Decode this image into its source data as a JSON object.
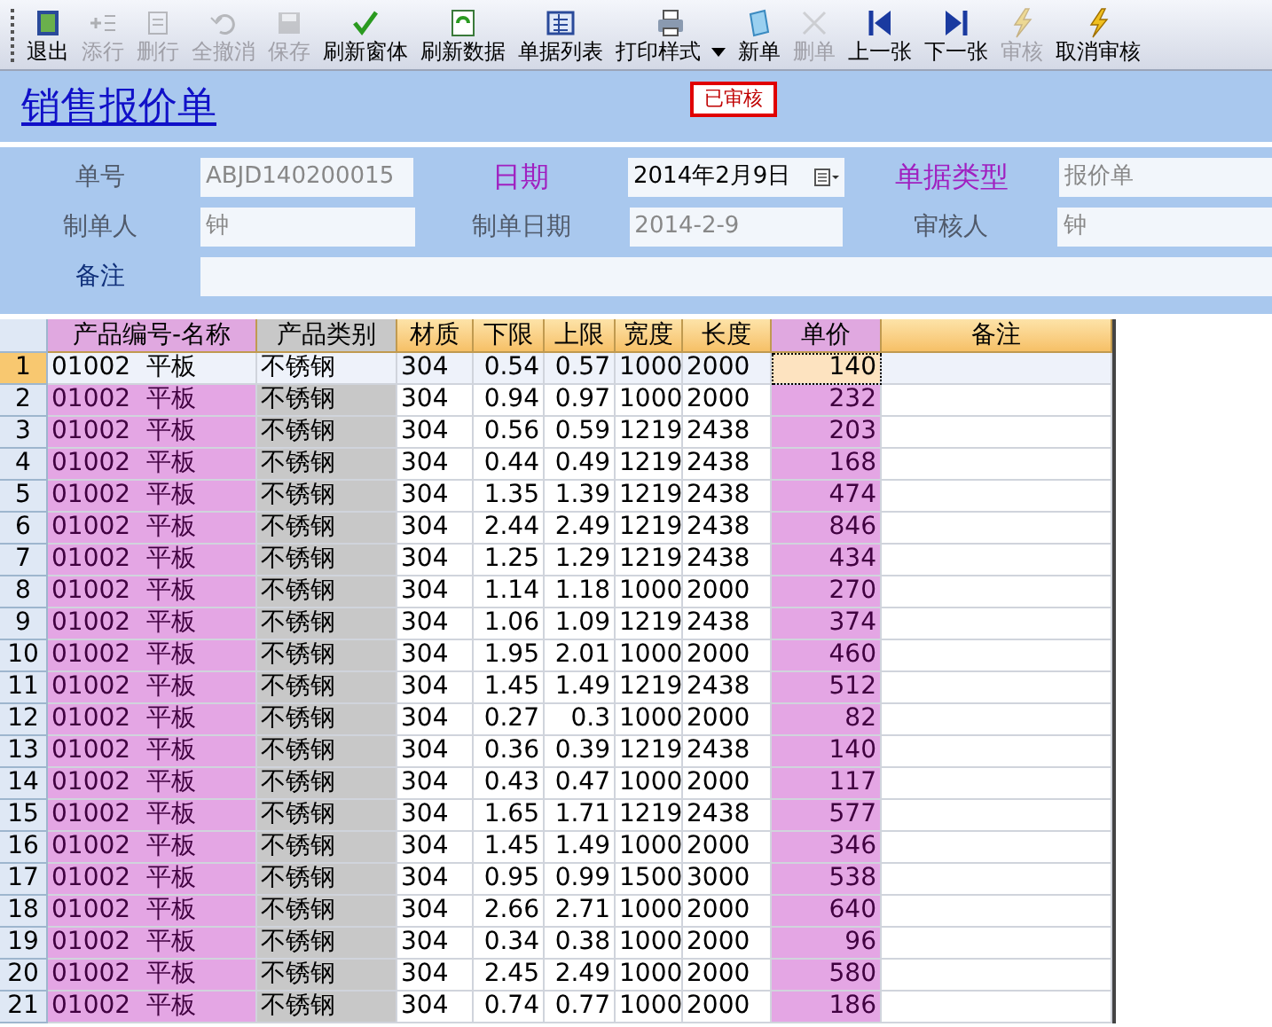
{
  "toolbar": [
    {
      "kind": "exit",
      "label": "退出",
      "disabled": false
    },
    {
      "kind": "add-row",
      "label": "添行",
      "disabled": true
    },
    {
      "kind": "delete-row",
      "label": "删行",
      "disabled": true
    },
    {
      "kind": "undo",
      "label": "全撤消",
      "disabled": true
    },
    {
      "kind": "save",
      "label": "保存",
      "disabled": true
    },
    {
      "kind": "check",
      "label": "刷新窗体",
      "disabled": false
    },
    {
      "kind": "refresh",
      "label": "刷新数据",
      "disabled": false
    },
    {
      "kind": "list",
      "label": "单据列表",
      "disabled": false
    },
    {
      "kind": "print",
      "label": "打印样式",
      "disabled": false,
      "dropdown": true
    },
    {
      "kind": "new",
      "label": "新单",
      "disabled": false
    },
    {
      "kind": "delete",
      "label": "删单",
      "disabled": true
    },
    {
      "kind": "prev",
      "label": "上一张",
      "disabled": false
    },
    {
      "kind": "next",
      "label": "下一张",
      "disabled": false
    },
    {
      "kind": "approve",
      "label": "审核",
      "disabled": true
    },
    {
      "kind": "approve",
      "label": "取消审核",
      "disabled": false
    }
  ],
  "title": "销售报价单",
  "status_badge": "已审核",
  "form": [
    [
      {
        "label": "单号",
        "emphasized": false,
        "value": "ABJD140200015",
        "kind": "readonly"
      },
      {
        "label": "日期",
        "emphasized": true,
        "value": "2014年2月9日",
        "kind": "date"
      },
      {
        "label": "单据类型",
        "emphasized": true,
        "value": "报价单",
        "kind": "readonly"
      }
    ],
    [
      {
        "label": "制单人",
        "emphasized": false,
        "value": "钟",
        "kind": "readonly"
      },
      {
        "label": "制单日期",
        "emphasized": false,
        "value": "2014-2-9",
        "kind": "readonly"
      },
      {
        "label": "审核人",
        "emphasized": false,
        "value": "钟",
        "kind": "readonly"
      }
    ],
    [
      {
        "label": "备注",
        "emphasized": false,
        "kind": "wide"
      }
    ]
  ],
  "table": {
    "columns": [
      {
        "label": "产品编号-名称",
        "kind": "pink"
      },
      {
        "label": "产品类别",
        "kind": "gray"
      },
      {
        "label": "材质",
        "kind": "plain"
      },
      {
        "label": "下限",
        "kind": "num"
      },
      {
        "label": "上限",
        "kind": "num"
      },
      {
        "label": "宽度",
        "kind": "num"
      },
      {
        "label": "长度",
        "kind": "plain"
      },
      {
        "label": "单价",
        "kind": "pinknum"
      },
      {
        "label": "备注",
        "kind": "plain"
      }
    ],
    "rows": [
      {
        "number": "1",
        "selected": true,
        "cells": [
          "01002  平板",
          "不锈钢",
          "304",
          "0.54",
          "0.57",
          "1000",
          "2000",
          "140",
          ""
        ]
      },
      {
        "number": "2",
        "selected": false,
        "cells": [
          "01002  平板",
          "不锈钢",
          "304",
          "0.94",
          "0.97",
          "1000",
          "2000",
          "232",
          ""
        ]
      },
      {
        "number": "3",
        "selected": false,
        "cells": [
          "01002  平板",
          "不锈钢",
          "304",
          "0.56",
          "0.59",
          "1219",
          "2438",
          "203",
          ""
        ]
      },
      {
        "number": "4",
        "selected": false,
        "cells": [
          "01002  平板",
          "不锈钢",
          "304",
          "0.44",
          "0.49",
          "1219",
          "2438",
          "168",
          ""
        ]
      },
      {
        "number": "5",
        "selected": false,
        "cells": [
          "01002  平板",
          "不锈钢",
          "304",
          "1.35",
          "1.39",
          "1219",
          "2438",
          "474",
          ""
        ]
      },
      {
        "number": "6",
        "selected": false,
        "cells": [
          "01002  平板",
          "不锈钢",
          "304",
          "2.44",
          "2.49",
          "1219",
          "2438",
          "846",
          ""
        ]
      },
      {
        "number": "7",
        "selected": false,
        "cells": [
          "01002  平板",
          "不锈钢",
          "304",
          "1.25",
          "1.29",
          "1219",
          "2438",
          "434",
          ""
        ]
      },
      {
        "number": "8",
        "selected": false,
        "cells": [
          "01002  平板",
          "不锈钢",
          "304",
          "1.14",
          "1.18",
          "1000",
          "2000",
          "270",
          ""
        ]
      },
      {
        "number": "9",
        "selected": false,
        "cells": [
          "01002  平板",
          "不锈钢",
          "304",
          "1.06",
          "1.09",
          "1219",
          "2438",
          "374",
          ""
        ]
      },
      {
        "number": "10",
        "selected": false,
        "cells": [
          "01002  平板",
          "不锈钢",
          "304",
          "1.95",
          "2.01",
          "1000",
          "2000",
          "460",
          ""
        ]
      },
      {
        "number": "11",
        "selected": false,
        "cells": [
          "01002  平板",
          "不锈钢",
          "304",
          "1.45",
          "1.49",
          "1219",
          "2438",
          "512",
          ""
        ]
      },
      {
        "number": "12",
        "selected": false,
        "cells": [
          "01002  平板",
          "不锈钢",
          "304",
          "0.27",
          "0.3",
          "1000",
          "2000",
          "82",
          ""
        ]
      },
      {
        "number": "13",
        "selected": false,
        "cells": [
          "01002  平板",
          "不锈钢",
          "304",
          "0.36",
          "0.39",
          "1219",
          "2438",
          "140",
          ""
        ]
      },
      {
        "number": "14",
        "selected": false,
        "cells": [
          "01002  平板",
          "不锈钢",
          "304",
          "0.43",
          "0.47",
          "1000",
          "2000",
          "117",
          ""
        ]
      },
      {
        "number": "15",
        "selected": false,
        "cells": [
          "01002  平板",
          "不锈钢",
          "304",
          "1.65",
          "1.71",
          "1219",
          "2438",
          "577",
          ""
        ]
      },
      {
        "number": "16",
        "selected": false,
        "cells": [
          "01002  平板",
          "不锈钢",
          "304",
          "1.45",
          "1.49",
          "1000",
          "2000",
          "346",
          ""
        ]
      },
      {
        "number": "17",
        "selected": false,
        "cells": [
          "01002  平板",
          "不锈钢",
          "304",
          "0.95",
          "0.99",
          "1500",
          "3000",
          "538",
          ""
        ]
      },
      {
        "number": "18",
        "selected": false,
        "cells": [
          "01002  平板",
          "不锈钢",
          "304",
          "2.66",
          "2.71",
          "1000",
          "2000",
          "640",
          ""
        ]
      },
      {
        "number": "19",
        "selected": false,
        "cells": [
          "01002  平板",
          "不锈钢",
          "304",
          "0.34",
          "0.38",
          "1000",
          "2000",
          "96",
          ""
        ]
      },
      {
        "number": "20",
        "selected": false,
        "cells": [
          "01002  平板",
          "不锈钢",
          "304",
          "2.45",
          "2.49",
          "1000",
          "2000",
          "580",
          ""
        ]
      },
      {
        "number": "21",
        "selected": false,
        "cells": [
          "01002  平板",
          "不锈钢",
          "304",
          "0.74",
          "0.77",
          "1000",
          "2000",
          "186",
          ""
        ]
      }
    ]
  }
}
